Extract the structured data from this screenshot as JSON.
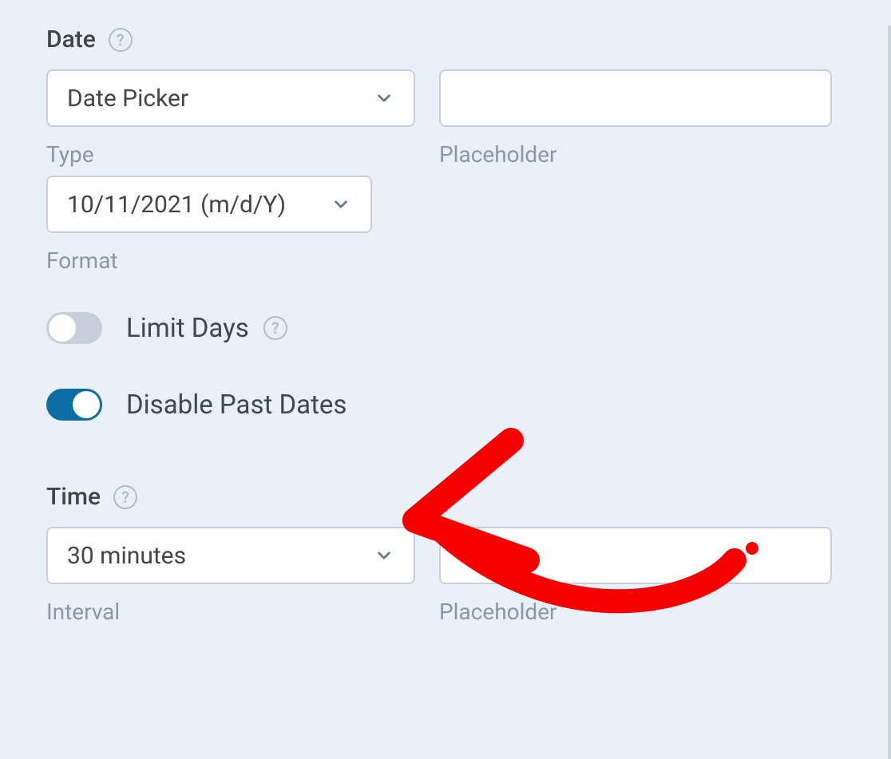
{
  "date": {
    "section_label": "Date",
    "type_select_value": "Date Picker",
    "type_sublabel": "Type",
    "placeholder_value": "",
    "placeholder_sublabel": "Placeholder",
    "format_select_value": "10/11/2021 (m/d/Y)",
    "format_sublabel": "Format"
  },
  "toggles": {
    "limit_days": {
      "label": "Limit Days",
      "on": false
    },
    "disable_past": {
      "label": "Disable Past Dates",
      "on": true
    }
  },
  "time": {
    "section_label": "Time",
    "interval_select_value": "30 minutes",
    "interval_sublabel": "Interval",
    "placeholder_value": "",
    "placeholder_sublabel": "Placeholder"
  }
}
